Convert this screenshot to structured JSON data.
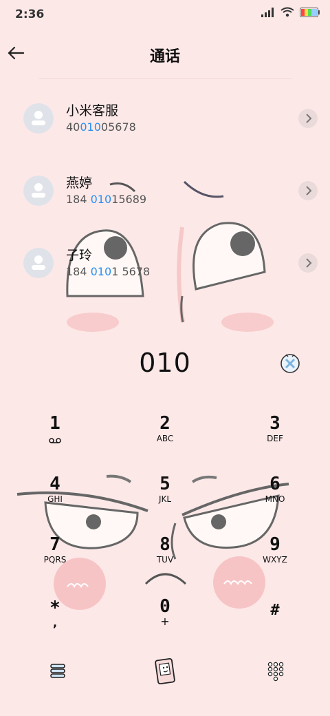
{
  "status": {
    "time": "2:36"
  },
  "header": {
    "title": "通话"
  },
  "contacts": [
    {
      "name": "小米客服",
      "num_pre": "40",
      "num_hl": "010",
      "num_post": "05678"
    },
    {
      "name": "燕婷",
      "num_pre": "184 ",
      "num_hl": "010",
      "num_post": "15689"
    },
    {
      "name": "子玲",
      "num_pre": "184 ",
      "num_hl": "010",
      "num_post": "1 5678"
    }
  ],
  "dialer": {
    "number": "010",
    "keys": [
      {
        "digit": "1",
        "letters": ""
      },
      {
        "digit": "2",
        "letters": "ABC"
      },
      {
        "digit": "3",
        "letters": "DEF"
      },
      {
        "digit": "4",
        "letters": "GHI"
      },
      {
        "digit": "5",
        "letters": "JKL"
      },
      {
        "digit": "6",
        "letters": "MNO"
      },
      {
        "digit": "7",
        "letters": "PQRS"
      },
      {
        "digit": "8",
        "letters": "TUV"
      },
      {
        "digit": "9",
        "letters": "WXYZ"
      },
      {
        "digit": "*",
        "letters": ","
      },
      {
        "digit": "0",
        "letters": "+"
      },
      {
        "digit": "#",
        "letters": ""
      }
    ]
  },
  "icons": [
    "back-arrow-icon",
    "signal-icon",
    "wifi-icon",
    "battery-icon",
    "chevron-right-icon",
    "delete-icon",
    "voicemail-icon",
    "menu-icon",
    "phone-icon",
    "dialpad-icon"
  ]
}
